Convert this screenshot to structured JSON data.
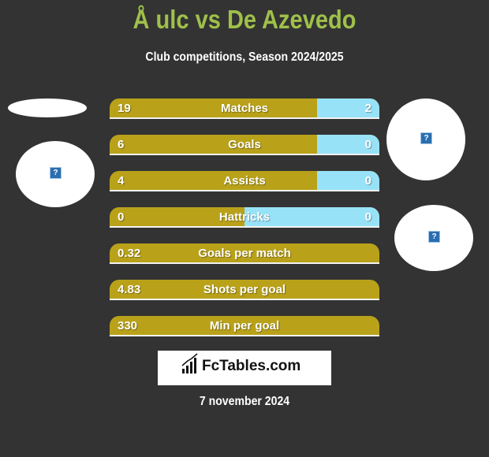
{
  "header": {
    "title": "Å ulc vs De Azevedo",
    "subtitle": "Club competitions, Season 2024/2025"
  },
  "colors": {
    "title": "#9fc04a",
    "left_bar": "#b9a21a",
    "right_bar": "#98e2f8",
    "background": "#333333"
  },
  "stats": [
    {
      "label": "Matches",
      "left": "19",
      "right": "2",
      "right_share": 0.23
    },
    {
      "label": "Goals",
      "left": "6",
      "right": "0",
      "right_share": 0.23
    },
    {
      "label": "Assists",
      "left": "4",
      "right": "0",
      "right_share": 0.23
    },
    {
      "label": "Hattricks",
      "left": "0",
      "right": "0",
      "right_share": 0.5
    },
    {
      "label": "Goals per match",
      "left": "0.32",
      "right": null,
      "right_share": 0
    },
    {
      "label": "Shots per goal",
      "left": "4.83",
      "right": null,
      "right_share": 0
    },
    {
      "label": "Min per goal",
      "left": "330",
      "right": null,
      "right_share": 0
    }
  ],
  "players": {
    "left_image_icon": "broken-image-icon",
    "right_image_icon": "broken-image-icon",
    "icon_glyph": "?"
  },
  "branding": {
    "logo_text": "FcTables.com",
    "logo_icon": "bar-chart-icon"
  },
  "footer": {
    "date": "7 november 2024"
  }
}
